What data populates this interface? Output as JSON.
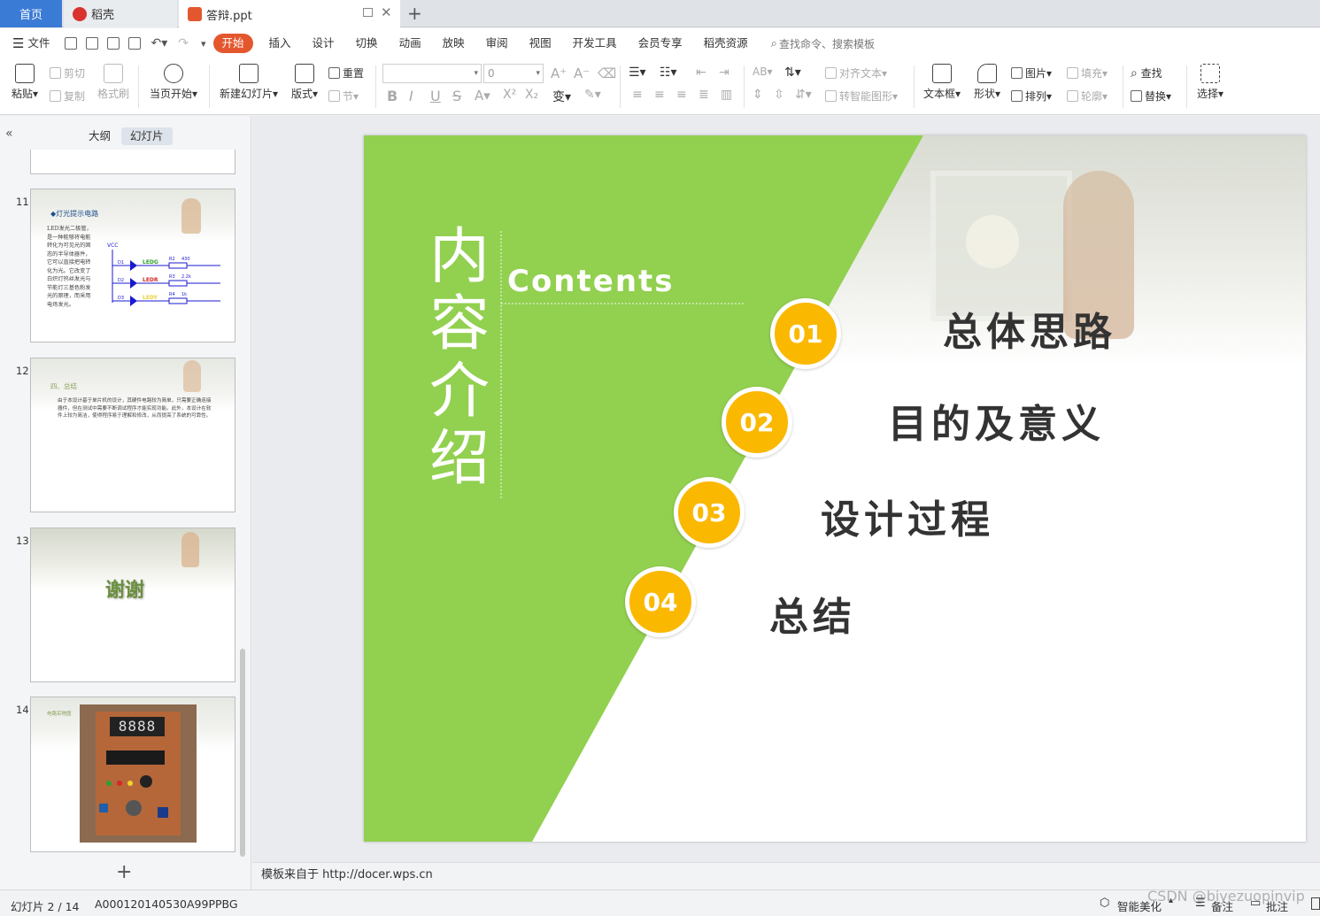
{
  "tabs": {
    "home": "首页",
    "daoke": "稻壳",
    "doc": "答辩.ppt"
  },
  "menu": {
    "file": "文件",
    "items": [
      "开始",
      "插入",
      "设计",
      "切换",
      "动画",
      "放映",
      "审阅",
      "视图",
      "开发工具",
      "会员专享",
      "稻壳资源"
    ],
    "active_index": 0,
    "search_placeholder": "查找命令、搜索模板"
  },
  "ribbon": {
    "paste": "粘贴",
    "cut": "剪切",
    "copy": "复制",
    "format_painter": "格式刷",
    "from_current": "当页开始",
    "new_slide": "新建幻灯片",
    "layout": "版式",
    "reset": "重置",
    "section": "节",
    "font_size": "0",
    "align_text": "对齐文本",
    "smart_shape": "转智能图形",
    "textbox": "文本框",
    "shape": "形状",
    "picture": "图片",
    "fill": "填充",
    "arrange": "排列",
    "outline": "轮廓",
    "find": "查找",
    "replace": "替换",
    "select": "选择"
  },
  "panel": {
    "tab_outline": "大纲",
    "tab_slides": "幻灯片",
    "collapse_icon": "double-chevron-left-icon"
  },
  "thumbnails": [
    {
      "num": "11",
      "title": "◆灯光提示电路",
      "body": "LED发光二极管，是一种能够将电能转化为可见光的固态的半导体器件，它可以直接把电转化为光。它改变了白炽灯钨丝发光与节能灯三基色粉发光的原理，而采用电场发光。",
      "labels": [
        "VCC",
        "LEDG",
        "LEDR",
        "LEDY",
        "R2",
        "R3",
        "R4",
        "430",
        "2.2k",
        "1k",
        "D1",
        "D2",
        "D3"
      ]
    },
    {
      "num": "12",
      "title": "四、总结",
      "body": "由于本设计基于单片机的设计，其硬件电路较为简单，只需要正确连接器件，但在测试中需要不断调试程序才能实现功能。此外，本设计在软件上较为简洁，使得程序易于理解和修改，从而提高了系统的可靠性。"
    },
    {
      "num": "13",
      "title": "谢谢"
    },
    {
      "num": "14",
      "title": "电路实物图"
    }
  ],
  "slide": {
    "title_cn": "内容介绍",
    "title_en": "Contents",
    "items": [
      {
        "num": "01",
        "text": "总体思路"
      },
      {
        "num": "02",
        "text": "目的及意义"
      },
      {
        "num": "03",
        "text": "设计过程"
      },
      {
        "num": "04",
        "text": "总结"
      }
    ],
    "colors": {
      "green": "#92d050",
      "accent": "#fbb800"
    }
  },
  "notes": "模板来自于 http://docer.wps.cn",
  "status": {
    "slide_info": "幻灯片 2 / 14",
    "template_id": "A000120140530A99PPBG",
    "smart_beautify": "智能美化",
    "comments": "备注",
    "annotate": "批注",
    "watermark": "CSDN @biyezuopinvip"
  }
}
